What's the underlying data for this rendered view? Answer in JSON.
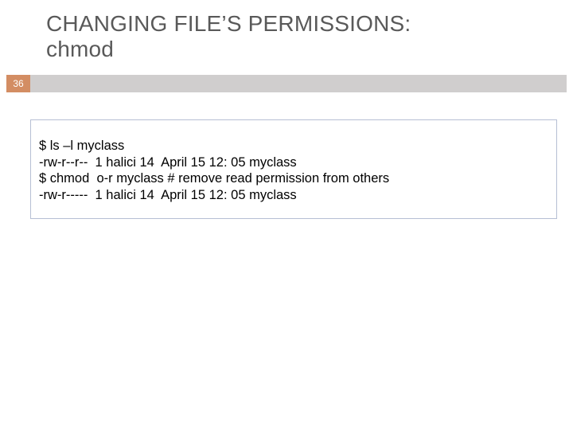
{
  "slide": {
    "title_line1": "CHANGING FILE’S PERMISSIONS:",
    "title_line2": "chmod",
    "page_number": "36"
  },
  "code": {
    "lines": [
      "$ ls –l myclass",
      "-rw-r--r--  1 halici 14  April 15 12: 05 myclass",
      "$ chmod  o-r myclass # remove read permission from others",
      "-rw-r-----  1 halici 14  April 15 12: 05 myclass"
    ]
  }
}
